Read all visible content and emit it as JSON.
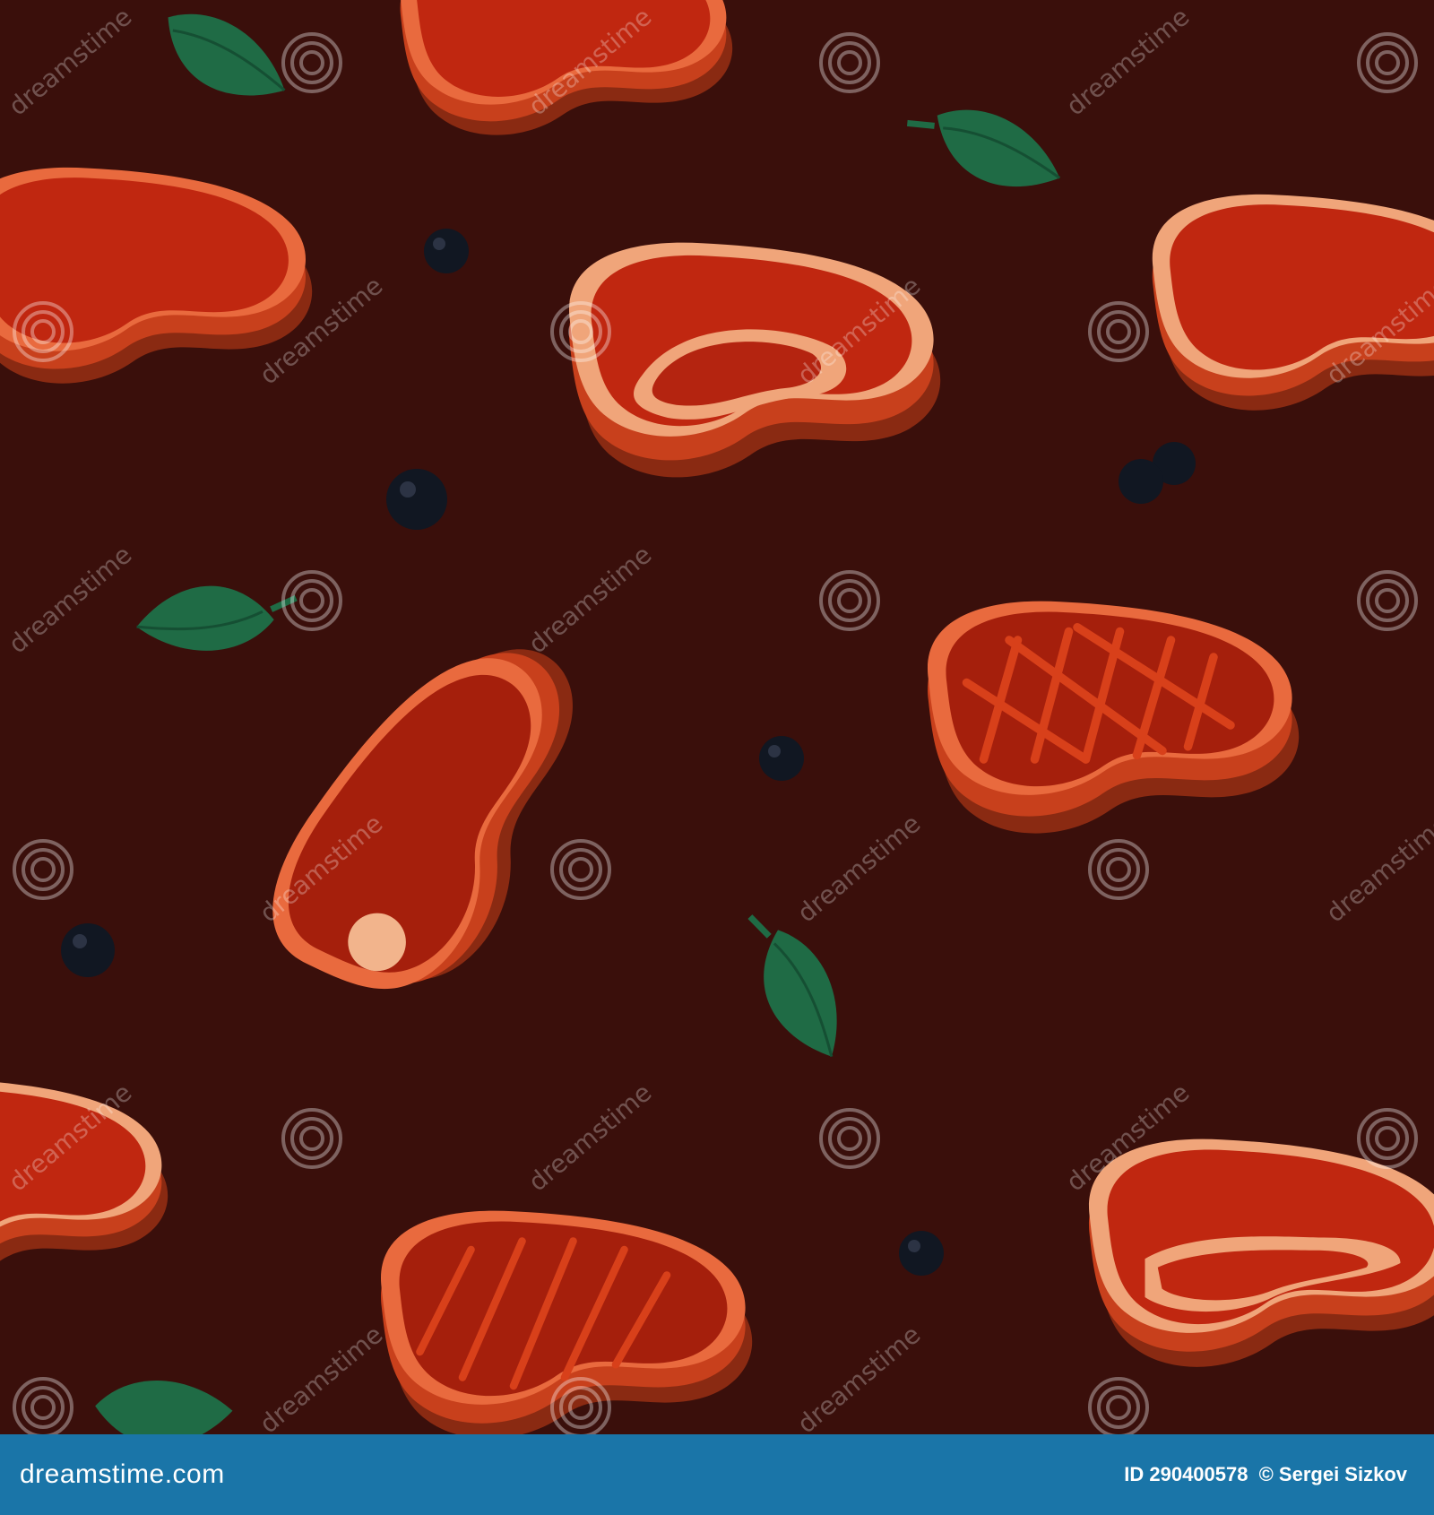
{
  "colors": {
    "background": "#3a0f0b",
    "meat_red": "#b8240f",
    "meat_side": "#c8401c",
    "fat": "#f0a57a",
    "leaf": "#1f6b45",
    "peppercorn": "#111722",
    "footer_bar": "#1a75a8"
  },
  "watermark": {
    "text": "dreamstime",
    "logo_icon": "spiral-logo-icon"
  },
  "footer": {
    "site_name": "dreamstime.com",
    "image_id": "ID 290400578",
    "author": "© Sergei Sizkov"
  },
  "icons": {
    "steak": "steak-icon",
    "leaf": "basil-leaf-icon",
    "peppercorn": "peppercorn-icon"
  }
}
